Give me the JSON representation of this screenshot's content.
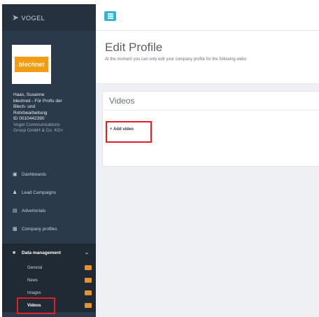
{
  "brand": {
    "logo_text": "VOGEL",
    "bird_icon": "bird-logo-icon"
  },
  "company": {
    "logo_text": "blechnet",
    "logo_color": "#f39c12"
  },
  "profile": {
    "name": "Haas, Susanne",
    "org_line1": "blechnet - Für Profis der",
    "org_line2": "Blech- und",
    "org_line3": "Rohrbearbeitung",
    "id": "ID 0010442390",
    "group_line1": "Vogel Communications",
    "group_line2": "Group GmbH & Co. KG+"
  },
  "nav": {
    "dashboards": "Dashboards",
    "lead_campaigns": "Lead Campaigns",
    "advertorials": "Advertorials",
    "company_profiles": "Company profiles",
    "data_management": "Data management",
    "sub": {
      "general": "General",
      "news": "News",
      "images": "Images",
      "videos": "Videos"
    }
  },
  "header": {
    "title": "Edit Profile",
    "subtitle": "At the moment you can only edit your company profile for the following webs"
  },
  "videos_panel": {
    "title": "Videos",
    "add_label": "+ Add video"
  },
  "colors": {
    "accent": "#28b9d6",
    "sidebar": "#2b3a4a",
    "highlight": "#e01f26",
    "badge": "#e8922e"
  }
}
